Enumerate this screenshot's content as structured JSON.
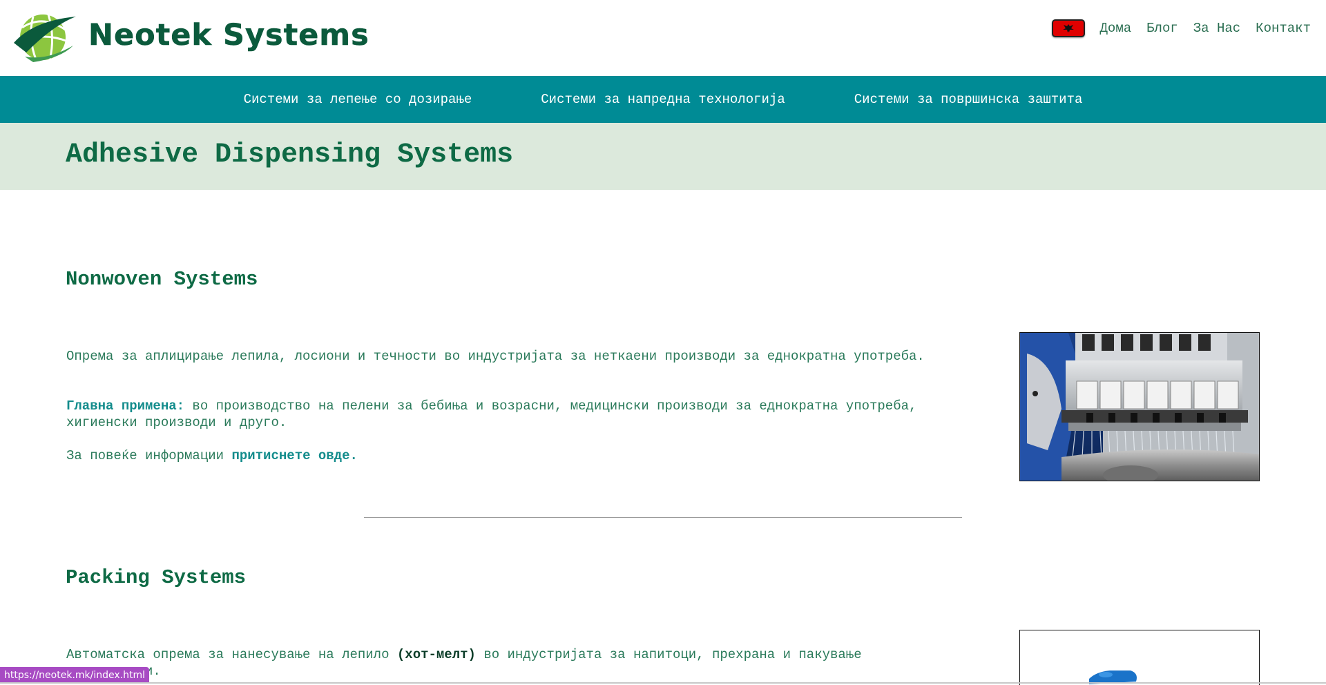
{
  "brand": {
    "name": "Neotek Systems",
    "colors": {
      "primary_green": "#0b5a3c",
      "light_green": "#8cc63f",
      "nav_teal": "#008b95",
      "banner_bg": "#dce9dc",
      "status_purple": "#a74bc3"
    }
  },
  "top_nav": {
    "language_flag": "albanian-flag-icon",
    "links": [
      "Дома",
      "Блог",
      "За Нас",
      "Контакт"
    ]
  },
  "main_nav": {
    "items": [
      "Системи за лепење со дозирање",
      "Системи за напредна технологија",
      "Системи за површинска заштита"
    ]
  },
  "banner": {
    "title": "Adhesive Dispensing Systems"
  },
  "sections": [
    {
      "title": "Nonwoven Systems",
      "description": "Опрема за аплицирање лепила, лосиони и течности во индустријата за неткаени производи за еднократна употреба.",
      "main_use_label": "Главна примена:",
      "main_use_text": " во производство на пелени за бебиња и возрасни, медицински производи за еднократна употреба, хигиенски производи и друго.",
      "more_info_text": "За повеќе информации ",
      "more_info_link": "притиснете овде."
    },
    {
      "title": "Packing Systems",
      "description_start": "Автоматска опрема за нанесување на лепило ",
      "description_bold": "(хот-мелт)",
      "description_end": " во индустријата за напитоци, прехрана и пакување",
      "description_line2": "  производи."
    }
  ],
  "status_bar": {
    "url": "https://neotek.mk/index.html"
  }
}
